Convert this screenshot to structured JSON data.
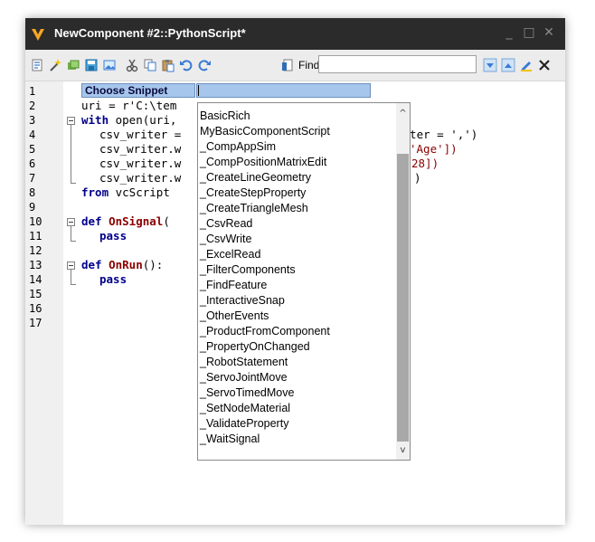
{
  "window": {
    "title": "NewComponent #2::PythonScript*",
    "minimize_glyph": "_",
    "maximize_glyph": "□",
    "close_glyph": "✕"
  },
  "toolbar": {
    "find_label": "Find",
    "find_value": "",
    "icons": [
      "new-icon",
      "wand-icon",
      "run-icon",
      "save-icon",
      "gallery-icon",
      "cut-icon",
      "copy-icon",
      "paste-icon",
      "undo-icon",
      "redo-icon",
      "document-icon",
      "find-down-icon",
      "find-up-icon",
      "highlight-icon",
      "clear-icon"
    ]
  },
  "editor": {
    "line_numbers": [
      "1",
      "2",
      "3",
      "4",
      "5",
      "6",
      "7",
      "8",
      "9",
      "10",
      "11",
      "12",
      "13",
      "14",
      "15",
      "16",
      "17"
    ],
    "snippet_label": "Choose Snippet",
    "code": {
      "l2": "uri = r'C:\\tem",
      "l3_kw": "with",
      "l3_rest": " open(uri,",
      "l4": "csv_writer =",
      "l4_right": "niter = ',')",
      "l5": "csv_writer.w",
      "l5_right": "'Age'])",
      "l6": "csv_writer.w",
      "l6_right": "28])",
      "l7": "csv_writer.w",
      "l7_right": ")",
      "l8_kw1": "from",
      "l8_rest": " vcScript",
      "l10_kw": "def",
      "l10_fn": "OnSignal",
      "l10_rest": "(",
      "l11_kw": "pass",
      "l13_kw": "def",
      "l13_fn": "OnRun",
      "l13_rest": "():",
      "l14_kw": "pass"
    }
  },
  "dropdown": {
    "items": [
      "BasicRich",
      "MyBasicComponentScript",
      "_CompAppSim",
      "_CompPositionMatrixEdit",
      "_CreateLineGeometry",
      "_CreateStepProperty",
      "_CreateTriangleMesh",
      "_CsvRead",
      "_CsvWrite",
      "_ExcelRead",
      "_FilterComponents",
      "_FindFeature",
      "_InteractiveSnap",
      "_OtherEvents",
      "_ProductFromComponent",
      "_PropertyOnChanged",
      "_RobotStatement",
      "_ServoJointMove",
      "_ServoTimedMove",
      "_SetNodeMaterial",
      "_ValidateProperty",
      "_WaitSignal"
    ],
    "scroll_up_glyph": "^",
    "scroll_down_glyph": "v"
  }
}
